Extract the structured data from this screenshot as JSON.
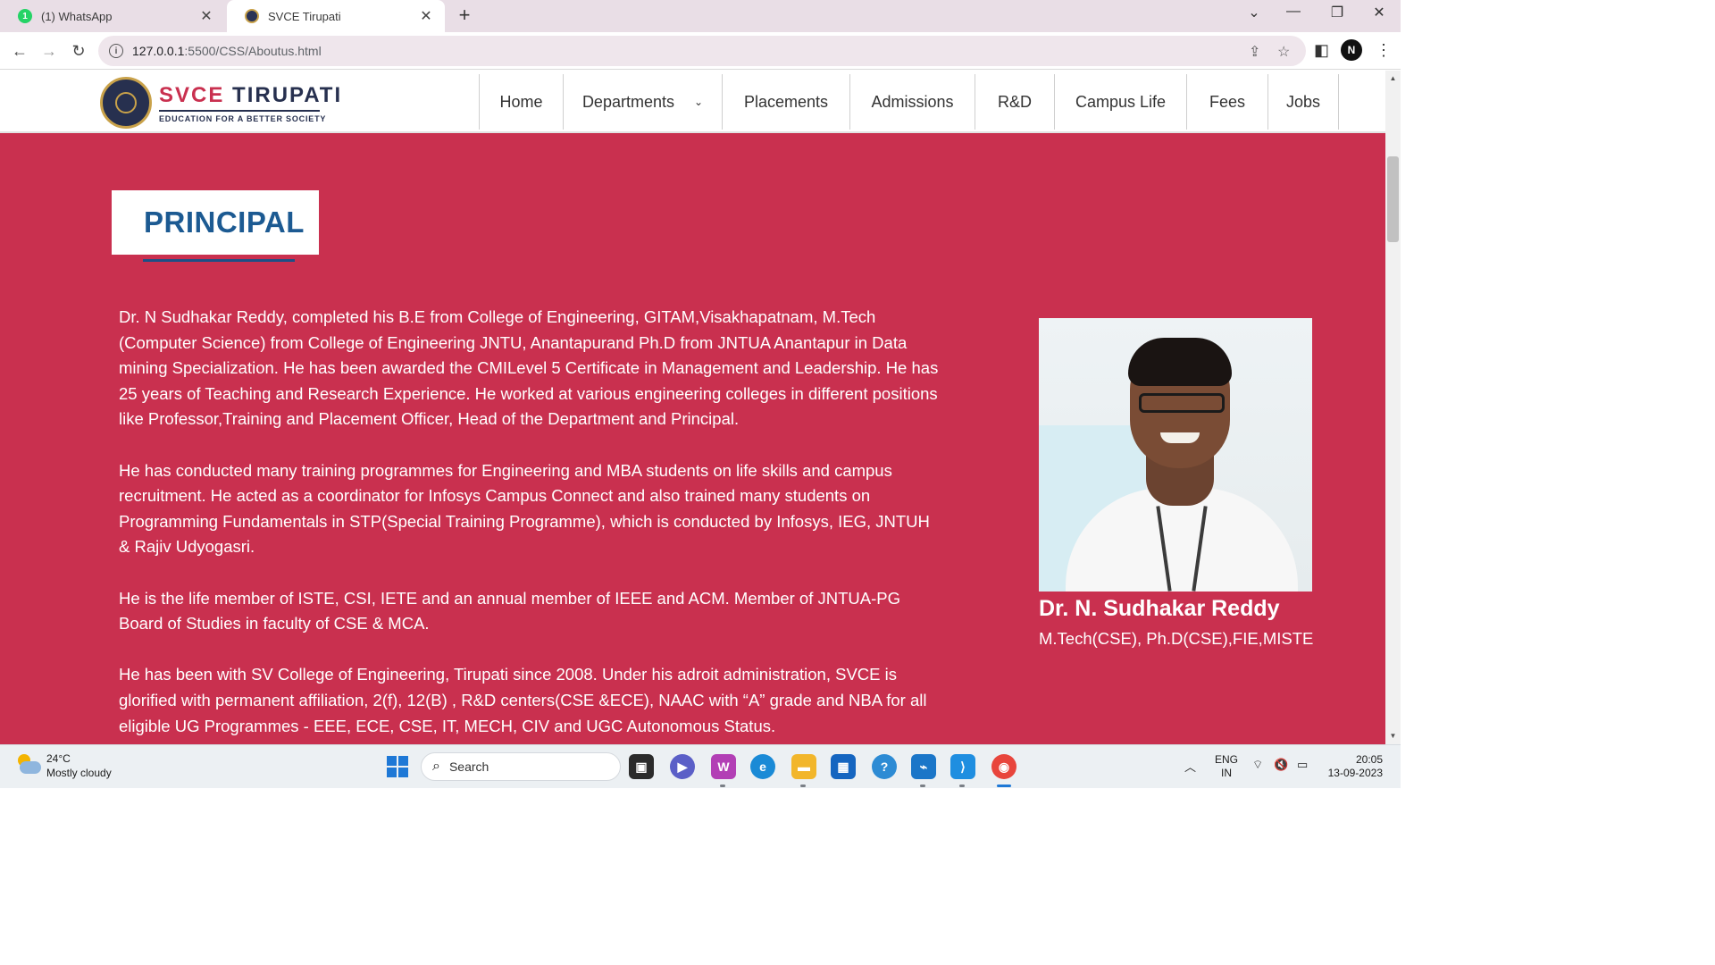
{
  "browser": {
    "tabs": [
      {
        "title": "(1) WhatsApp",
        "favicon": "whatsapp-icon",
        "badge": "1",
        "active": false
      },
      {
        "title": "SVCE Tirupati",
        "favicon": "svce-logo-icon",
        "active": true
      }
    ],
    "url_host": "127.0.0.1",
    "url_rest": ":5500/CSS/Aboutus.html",
    "profile_initial": "N"
  },
  "site": {
    "logo": {
      "name_part1": "SVCE",
      "name_part2": "TIRUPATI",
      "tagline": "EDUCATION FOR A BETTER SOCIETY"
    },
    "nav": [
      {
        "label": "Home"
      },
      {
        "label": "Departments",
        "has_dropdown": true
      },
      {
        "label": "Placements"
      },
      {
        "label": "Admissions"
      },
      {
        "label": "R&D"
      },
      {
        "label": "Campus Life"
      },
      {
        "label": "Fees"
      },
      {
        "label": "Jobs"
      }
    ]
  },
  "principal": {
    "heading": "PRINCIPAL",
    "paragraphs": [
      "Dr. N Sudhakar Reddy, completed his B.E from College of Engineering, GITAM,Visakhapatnam, M.Tech (Computer Science) from College of Engineering JNTU, Anantapurand Ph.D from JNTUA Anantapur in Data mining Specialization. He has been awarded the CMILevel 5 Certificate in Management and Leadership. He has 25 years of Teaching and Research Experience. He worked at various engineering colleges in different positions like Professor,Training and Placement Officer, Head of the Department and Principal.",
      "He has conducted many training programmes for Engineering and MBA students on life skills and campus recruitment. He acted as a coordinator for Infosys Campus Connect and also trained many students on Programming Fundamentals in STP(Special Training Programme), which is conducted by Infosys, IEG, JNTUH & Rajiv Udyogasri.",
      "He is the life member of ISTE, CSI, IETE and an annual member of IEEE and ACM. Member of JNTUA-PG Board of Studies in faculty of CSE & MCA.",
      "He has been with SV College of Engineering, Tirupati since 2008. Under his adroit administration, SVCE is glorified with permanent affiliation, 2(f), 12(B) , R&D centers(CSE &ECE), NAAC with “A” grade and NBA for all eligible UG Programmes - EEE, ECE, CSE, IT, MECH, CIV and UGC Autonomous Status."
    ],
    "name": "Dr. N. Sudhakar Reddy",
    "qualifications": "M.Tech(CSE), Ph.D(CSE),FIE,MISTE"
  },
  "taskbar": {
    "weather_temp": "24°C",
    "weather_desc": "Mostly cloudy",
    "search_label": "Search",
    "lang_line1": "ENG",
    "lang_line2": "IN",
    "time": "20:05",
    "date": "13-09-2023"
  },
  "colors": {
    "page_bg": "#c9304f",
    "heading_blue": "#1c5a92",
    "logo_navy": "#27304f",
    "logo_red": "#c9304f"
  }
}
